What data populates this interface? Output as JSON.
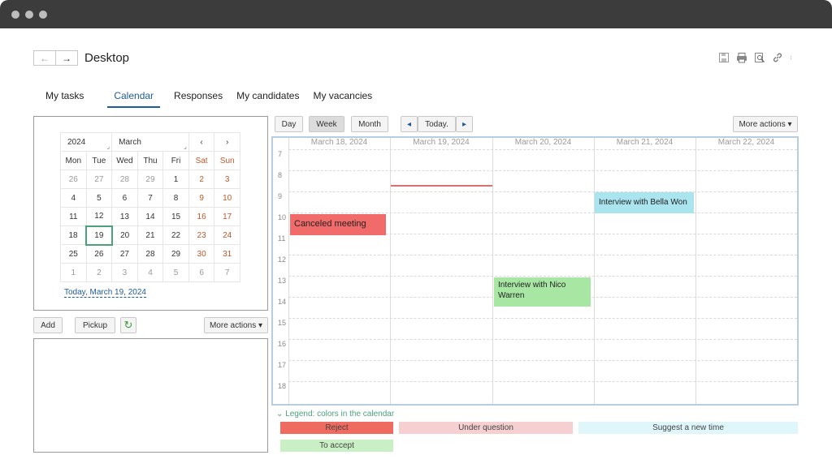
{
  "header": {
    "title": "Desktop",
    "back_icon": "arrow-left-icon",
    "forward_icon": "arrow-right-icon"
  },
  "tabs": [
    {
      "label": "My tasks"
    },
    {
      "label": "Calendar",
      "active": true
    },
    {
      "label": "Responses"
    },
    {
      "label": "My candidates"
    },
    {
      "label": "My vacancies"
    }
  ],
  "mini_calendar": {
    "year": "2024",
    "month": "March",
    "prev": "‹",
    "next": "›",
    "weekdays": [
      "Mon",
      "Tue",
      "Wed",
      "Thu",
      "Fri",
      "Sat",
      "Sun"
    ],
    "weeks": [
      [
        "26",
        "27",
        "28",
        "29",
        "1",
        "2",
        "3"
      ],
      [
        "4",
        "5",
        "6",
        "7",
        "8",
        "9",
        "10"
      ],
      [
        "11",
        "12",
        "13",
        "14",
        "15",
        "16",
        "17"
      ],
      [
        "18",
        "19",
        "20",
        "21",
        "22",
        "23",
        "24"
      ],
      [
        "25",
        "26",
        "27",
        "28",
        "29",
        "30",
        "31"
      ],
      [
        "1",
        "2",
        "3",
        "4",
        "5",
        "6",
        "7"
      ]
    ],
    "today_link": "Today, March 19, 2024"
  },
  "task_toolbar": {
    "add": "Add",
    "pickup": "Pickup",
    "more_actions": "More actions ▾"
  },
  "calendar_toolbar": {
    "day": "Day",
    "week": "Week",
    "month": "Month",
    "prev": "◂",
    "today": "Today.",
    "next": "▸",
    "more_actions": "More actions ▾"
  },
  "week_view": {
    "days": [
      "March 18, 2024",
      "March 19, 2024",
      "March 20, 2024",
      "March 21, 2024",
      "March 22, 2024"
    ],
    "hours": [
      "7",
      "8",
      "9",
      "10",
      "11",
      "12",
      "13",
      "14",
      "15",
      "16",
      "17",
      "18"
    ],
    "events": [
      {
        "title": "Canceled meeting",
        "color": "#f26b6b"
      },
      {
        "title": "Interview with Bella Won",
        "color": "#a9e4ef"
      },
      {
        "title": "Interview with Nico Warren",
        "color": "#a8e6a3"
      }
    ]
  },
  "legend": {
    "title": "Legend: colors in the calendar",
    "items": [
      {
        "label": "Reject",
        "color": "#ef6a5f"
      },
      {
        "label": "Under question",
        "color": "#f6d0d0"
      },
      {
        "label": "Suggest a new time",
        "color": "#dff6fb"
      },
      {
        "label": "To accept",
        "color": "#c9efc4"
      }
    ]
  }
}
